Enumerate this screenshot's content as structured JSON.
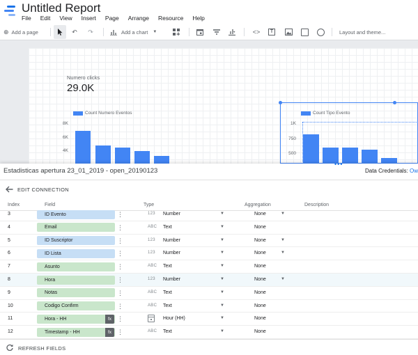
{
  "app": {
    "title": "Untitled Report",
    "menu": [
      "File",
      "Edit",
      "View",
      "Insert",
      "Page",
      "Arrange",
      "Resource",
      "Help"
    ]
  },
  "toolbar": {
    "add_page": "Add a page",
    "add_chart": "Add a chart",
    "layout_theme": "Layout and theme..."
  },
  "canvas": {
    "scorecard": {
      "label": "Numero clicks",
      "value": "29.0K"
    },
    "chart_left": {
      "legend": "Count Numero Eventos",
      "ticks": [
        "8K",
        "6K",
        "4K"
      ]
    },
    "chart_right": {
      "legend": "Count Tipo Evento",
      "ticks": [
        "1K",
        "750",
        "500"
      ]
    }
  },
  "panel": {
    "title": "Estadisticas apertura 23_01_2019 - open_20190123",
    "credentials_label": "Data Credentials: ",
    "credentials_value": "Ow",
    "edit_connection": "EDIT CONNECTION",
    "headers": {
      "index": "Index",
      "field": "Field",
      "type": "Type",
      "aggregation": "Aggregation",
      "description": "Description"
    },
    "rows": [
      {
        "index": "3",
        "field": "ID Evento",
        "kind": "dim",
        "type_icon": "123",
        "type": "Number",
        "aggregation": "None",
        "agg_dropdown": true
      },
      {
        "index": "4",
        "field": "Email",
        "kind": "met",
        "type_icon": "ABC",
        "type": "Text",
        "aggregation": "None",
        "agg_dropdown": false
      },
      {
        "index": "5",
        "field": "ID Suscriptor",
        "kind": "dim",
        "type_icon": "123",
        "type": "Number",
        "aggregation": "None",
        "agg_dropdown": true
      },
      {
        "index": "6",
        "field": "ID Lista",
        "kind": "dim",
        "type_icon": "123",
        "type": "Number",
        "aggregation": "None",
        "agg_dropdown": true
      },
      {
        "index": "7",
        "field": "Asunto",
        "kind": "met",
        "type_icon": "ABC",
        "type": "Text",
        "aggregation": "None",
        "agg_dropdown": false
      },
      {
        "index": "8",
        "field": "Hora",
        "kind": "met",
        "type_icon": "123",
        "type": "Number",
        "aggregation": "None",
        "agg_dropdown": true
      },
      {
        "index": "9",
        "field": "Notas",
        "kind": "met",
        "type_icon": "ABC",
        "type": "Text",
        "aggregation": "None",
        "agg_dropdown": false
      },
      {
        "index": "10",
        "field": "Codigo Confirm",
        "kind": "met",
        "type_icon": "ABC",
        "type": "Text",
        "aggregation": "None",
        "agg_dropdown": false
      },
      {
        "index": "11",
        "field": "Hora - HH",
        "kind": "met",
        "type_icon": "calendar",
        "type": "Hour (HH)",
        "aggregation": "None",
        "agg_dropdown": false,
        "fx": "fx"
      },
      {
        "index": "12",
        "field": "Timestamp - HH",
        "kind": "met",
        "type_icon": "ABC",
        "type": "Text",
        "aggregation": "None",
        "agg_dropdown": false,
        "fx": "fx"
      }
    ],
    "refresh": "REFRESH FIELDS"
  },
  "colors": {
    "accent": "#4285f4",
    "dimension": "#c6def5",
    "metric": "#c9e6cb"
  }
}
